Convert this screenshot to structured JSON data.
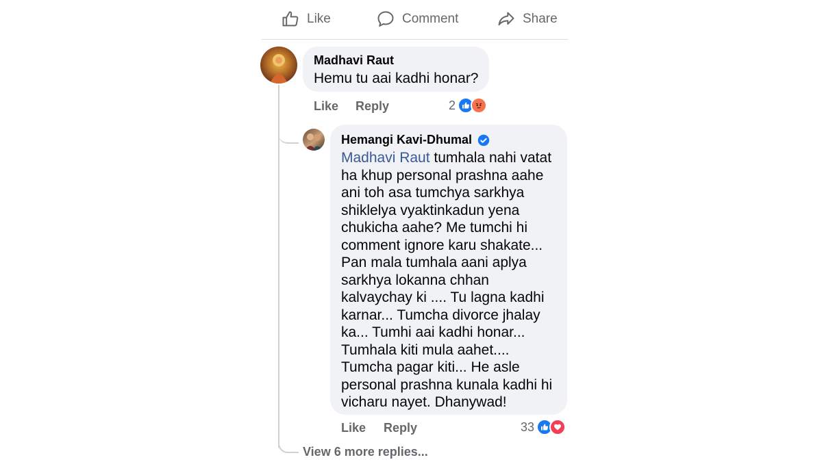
{
  "actions": {
    "like": "Like",
    "comment": "Comment",
    "share": "Share"
  },
  "comment1": {
    "author": "Madhavi Raut",
    "text": "Hemu tu aai kadhi honar?",
    "like": "Like",
    "reply": "Reply",
    "reaction_count": "2",
    "reactions": [
      "like-icon",
      "angry-icon"
    ]
  },
  "reply1": {
    "author": "Hemangi Kavi-Dhumal",
    "mention": "Madhavi Raut",
    "lines": [
      " tumhala nahi vatat",
      "ha khup personal prashna aahe",
      "ani toh asa tumchya sarkhya",
      "shiklelya vyaktinkadun yena",
      "chukicha aahe? Me tumchi hi",
      "comment ignore karu shakate...",
      "Pan mala tumhala aani aplya",
      "sarkhya lokanna chhan",
      "kalvaychay ki .... Tu lagna kadhi",
      "karnar... Tumcha divorce jhalay",
      "ka... Tumhi aai kadhi honar...",
      "Tumhala kiti mula aahet....",
      "Tumcha pagar kiti... He asle",
      "personal prashna kunala kadhi hi",
      "vicharu nayet. Dhanywad!"
    ],
    "like": "Like",
    "reply": "Reply",
    "reaction_count": "33",
    "reactions": [
      "like-icon",
      "love-icon"
    ],
    "verified_color": "#1877f2"
  },
  "more_replies": "View 6 more replies..."
}
